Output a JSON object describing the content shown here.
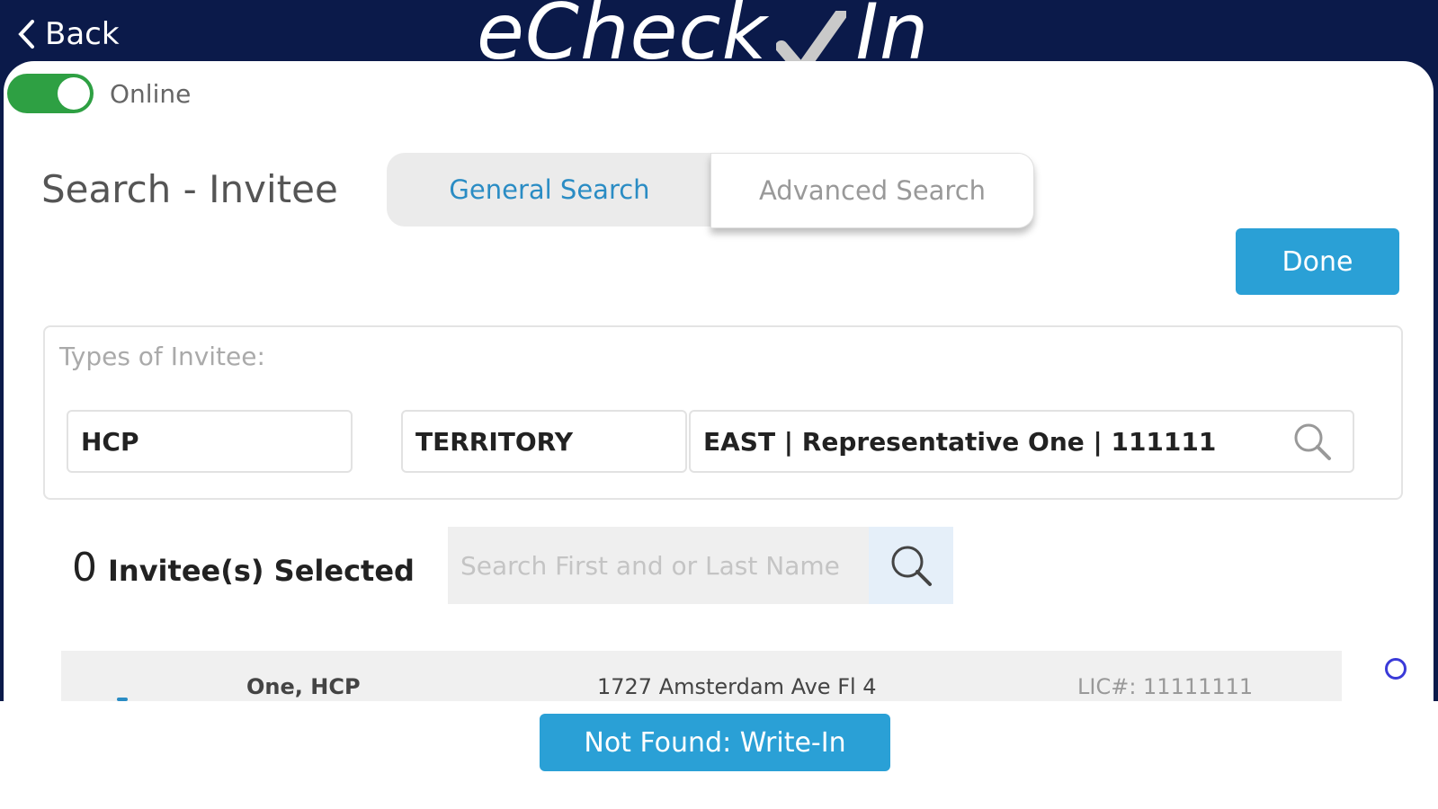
{
  "header": {
    "back_label": "Back",
    "logo_left": "eCheck",
    "logo_right": "In"
  },
  "status": {
    "online_label": "Online",
    "online_on": true,
    "toggle_color": "#2ea043"
  },
  "page": {
    "title": "Search - Invitee"
  },
  "tabs": [
    {
      "label": "General Search",
      "active": true
    },
    {
      "label": "Advanced Search",
      "active": false
    }
  ],
  "done_label": "Done",
  "types": {
    "label": "Types of Invitee:",
    "type_value": "HCP",
    "filter_value": "TERRITORY",
    "territory_value": "EAST | Representative One | 111111"
  },
  "selection": {
    "count": "0",
    "label": "Invitee(s) Selected"
  },
  "name_search": {
    "placeholder": "Search First and or Last Name"
  },
  "results": [
    {
      "name": "One, HCP",
      "address": "1727 Amsterdam Ave Fl 4",
      "license": "LIC#: 11111111"
    }
  ],
  "footer": {
    "write_in_label": "Not Found: Write-In"
  },
  "colors": {
    "header_bg": "#0b1a4a",
    "accent": "#2aa0d6",
    "tab_active_text": "#2a8cc4"
  }
}
